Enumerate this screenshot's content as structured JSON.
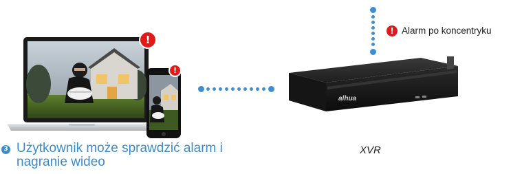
{
  "alarm": {
    "label": "Alarm po koncentryku",
    "badge_symbol": "!"
  },
  "user_step": {
    "number": "3",
    "text": "Użytkownik może sprawdzić alarm i nagranie wideo"
  },
  "device": {
    "name": "XVR",
    "brand": "alhua"
  },
  "colors": {
    "accent": "#3a8ccd",
    "alarm": "#e01919"
  },
  "icons": [
    "laptop-icon",
    "smartphone-icon",
    "dvr-recorder-icon",
    "alarm-badge-icon"
  ]
}
